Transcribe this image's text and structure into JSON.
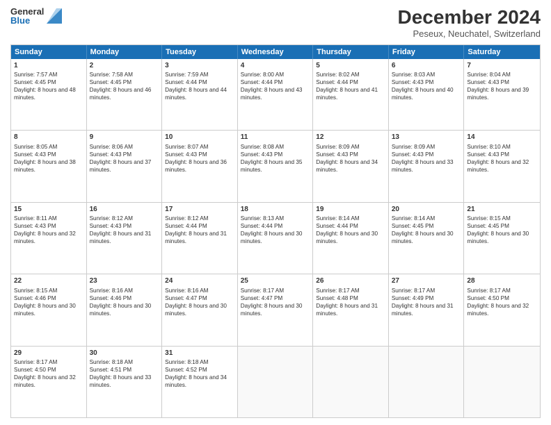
{
  "header": {
    "logo_general": "General",
    "logo_blue": "Blue",
    "month_title": "December 2024",
    "location": "Peseux, Neuchatel, Switzerland"
  },
  "days_of_week": [
    "Sunday",
    "Monday",
    "Tuesday",
    "Wednesday",
    "Thursday",
    "Friday",
    "Saturday"
  ],
  "weeks": [
    [
      {
        "day": "1",
        "sunrise": "Sunrise: 7:57 AM",
        "sunset": "Sunset: 4:45 PM",
        "daylight": "Daylight: 8 hours and 48 minutes."
      },
      {
        "day": "2",
        "sunrise": "Sunrise: 7:58 AM",
        "sunset": "Sunset: 4:45 PM",
        "daylight": "Daylight: 8 hours and 46 minutes."
      },
      {
        "day": "3",
        "sunrise": "Sunrise: 7:59 AM",
        "sunset": "Sunset: 4:44 PM",
        "daylight": "Daylight: 8 hours and 44 minutes."
      },
      {
        "day": "4",
        "sunrise": "Sunrise: 8:00 AM",
        "sunset": "Sunset: 4:44 PM",
        "daylight": "Daylight: 8 hours and 43 minutes."
      },
      {
        "day": "5",
        "sunrise": "Sunrise: 8:02 AM",
        "sunset": "Sunset: 4:44 PM",
        "daylight": "Daylight: 8 hours and 41 minutes."
      },
      {
        "day": "6",
        "sunrise": "Sunrise: 8:03 AM",
        "sunset": "Sunset: 4:43 PM",
        "daylight": "Daylight: 8 hours and 40 minutes."
      },
      {
        "day": "7",
        "sunrise": "Sunrise: 8:04 AM",
        "sunset": "Sunset: 4:43 PM",
        "daylight": "Daylight: 8 hours and 39 minutes."
      }
    ],
    [
      {
        "day": "8",
        "sunrise": "Sunrise: 8:05 AM",
        "sunset": "Sunset: 4:43 PM",
        "daylight": "Daylight: 8 hours and 38 minutes."
      },
      {
        "day": "9",
        "sunrise": "Sunrise: 8:06 AM",
        "sunset": "Sunset: 4:43 PM",
        "daylight": "Daylight: 8 hours and 37 minutes."
      },
      {
        "day": "10",
        "sunrise": "Sunrise: 8:07 AM",
        "sunset": "Sunset: 4:43 PM",
        "daylight": "Daylight: 8 hours and 36 minutes."
      },
      {
        "day": "11",
        "sunrise": "Sunrise: 8:08 AM",
        "sunset": "Sunset: 4:43 PM",
        "daylight": "Daylight: 8 hours and 35 minutes."
      },
      {
        "day": "12",
        "sunrise": "Sunrise: 8:09 AM",
        "sunset": "Sunset: 4:43 PM",
        "daylight": "Daylight: 8 hours and 34 minutes."
      },
      {
        "day": "13",
        "sunrise": "Sunrise: 8:09 AM",
        "sunset": "Sunset: 4:43 PM",
        "daylight": "Daylight: 8 hours and 33 minutes."
      },
      {
        "day": "14",
        "sunrise": "Sunrise: 8:10 AM",
        "sunset": "Sunset: 4:43 PM",
        "daylight": "Daylight: 8 hours and 32 minutes."
      }
    ],
    [
      {
        "day": "15",
        "sunrise": "Sunrise: 8:11 AM",
        "sunset": "Sunset: 4:43 PM",
        "daylight": "Daylight: 8 hours and 32 minutes."
      },
      {
        "day": "16",
        "sunrise": "Sunrise: 8:12 AM",
        "sunset": "Sunset: 4:43 PM",
        "daylight": "Daylight: 8 hours and 31 minutes."
      },
      {
        "day": "17",
        "sunrise": "Sunrise: 8:12 AM",
        "sunset": "Sunset: 4:44 PM",
        "daylight": "Daylight: 8 hours and 31 minutes."
      },
      {
        "day": "18",
        "sunrise": "Sunrise: 8:13 AM",
        "sunset": "Sunset: 4:44 PM",
        "daylight": "Daylight: 8 hours and 30 minutes."
      },
      {
        "day": "19",
        "sunrise": "Sunrise: 8:14 AM",
        "sunset": "Sunset: 4:44 PM",
        "daylight": "Daylight: 8 hours and 30 minutes."
      },
      {
        "day": "20",
        "sunrise": "Sunrise: 8:14 AM",
        "sunset": "Sunset: 4:45 PM",
        "daylight": "Daylight: 8 hours and 30 minutes."
      },
      {
        "day": "21",
        "sunrise": "Sunrise: 8:15 AM",
        "sunset": "Sunset: 4:45 PM",
        "daylight": "Daylight: 8 hours and 30 minutes."
      }
    ],
    [
      {
        "day": "22",
        "sunrise": "Sunrise: 8:15 AM",
        "sunset": "Sunset: 4:46 PM",
        "daylight": "Daylight: 8 hours and 30 minutes."
      },
      {
        "day": "23",
        "sunrise": "Sunrise: 8:16 AM",
        "sunset": "Sunset: 4:46 PM",
        "daylight": "Daylight: 8 hours and 30 minutes."
      },
      {
        "day": "24",
        "sunrise": "Sunrise: 8:16 AM",
        "sunset": "Sunset: 4:47 PM",
        "daylight": "Daylight: 8 hours and 30 minutes."
      },
      {
        "day": "25",
        "sunrise": "Sunrise: 8:17 AM",
        "sunset": "Sunset: 4:47 PM",
        "daylight": "Daylight: 8 hours and 30 minutes."
      },
      {
        "day": "26",
        "sunrise": "Sunrise: 8:17 AM",
        "sunset": "Sunset: 4:48 PM",
        "daylight": "Daylight: 8 hours and 31 minutes."
      },
      {
        "day": "27",
        "sunrise": "Sunrise: 8:17 AM",
        "sunset": "Sunset: 4:49 PM",
        "daylight": "Daylight: 8 hours and 31 minutes."
      },
      {
        "day": "28",
        "sunrise": "Sunrise: 8:17 AM",
        "sunset": "Sunset: 4:50 PM",
        "daylight": "Daylight: 8 hours and 32 minutes."
      }
    ],
    [
      {
        "day": "29",
        "sunrise": "Sunrise: 8:17 AM",
        "sunset": "Sunset: 4:50 PM",
        "daylight": "Daylight: 8 hours and 32 minutes."
      },
      {
        "day": "30",
        "sunrise": "Sunrise: 8:18 AM",
        "sunset": "Sunset: 4:51 PM",
        "daylight": "Daylight: 8 hours and 33 minutes."
      },
      {
        "day": "31",
        "sunrise": "Sunrise: 8:18 AM",
        "sunset": "Sunset: 4:52 PM",
        "daylight": "Daylight: 8 hours and 34 minutes."
      },
      null,
      null,
      null,
      null
    ]
  ]
}
